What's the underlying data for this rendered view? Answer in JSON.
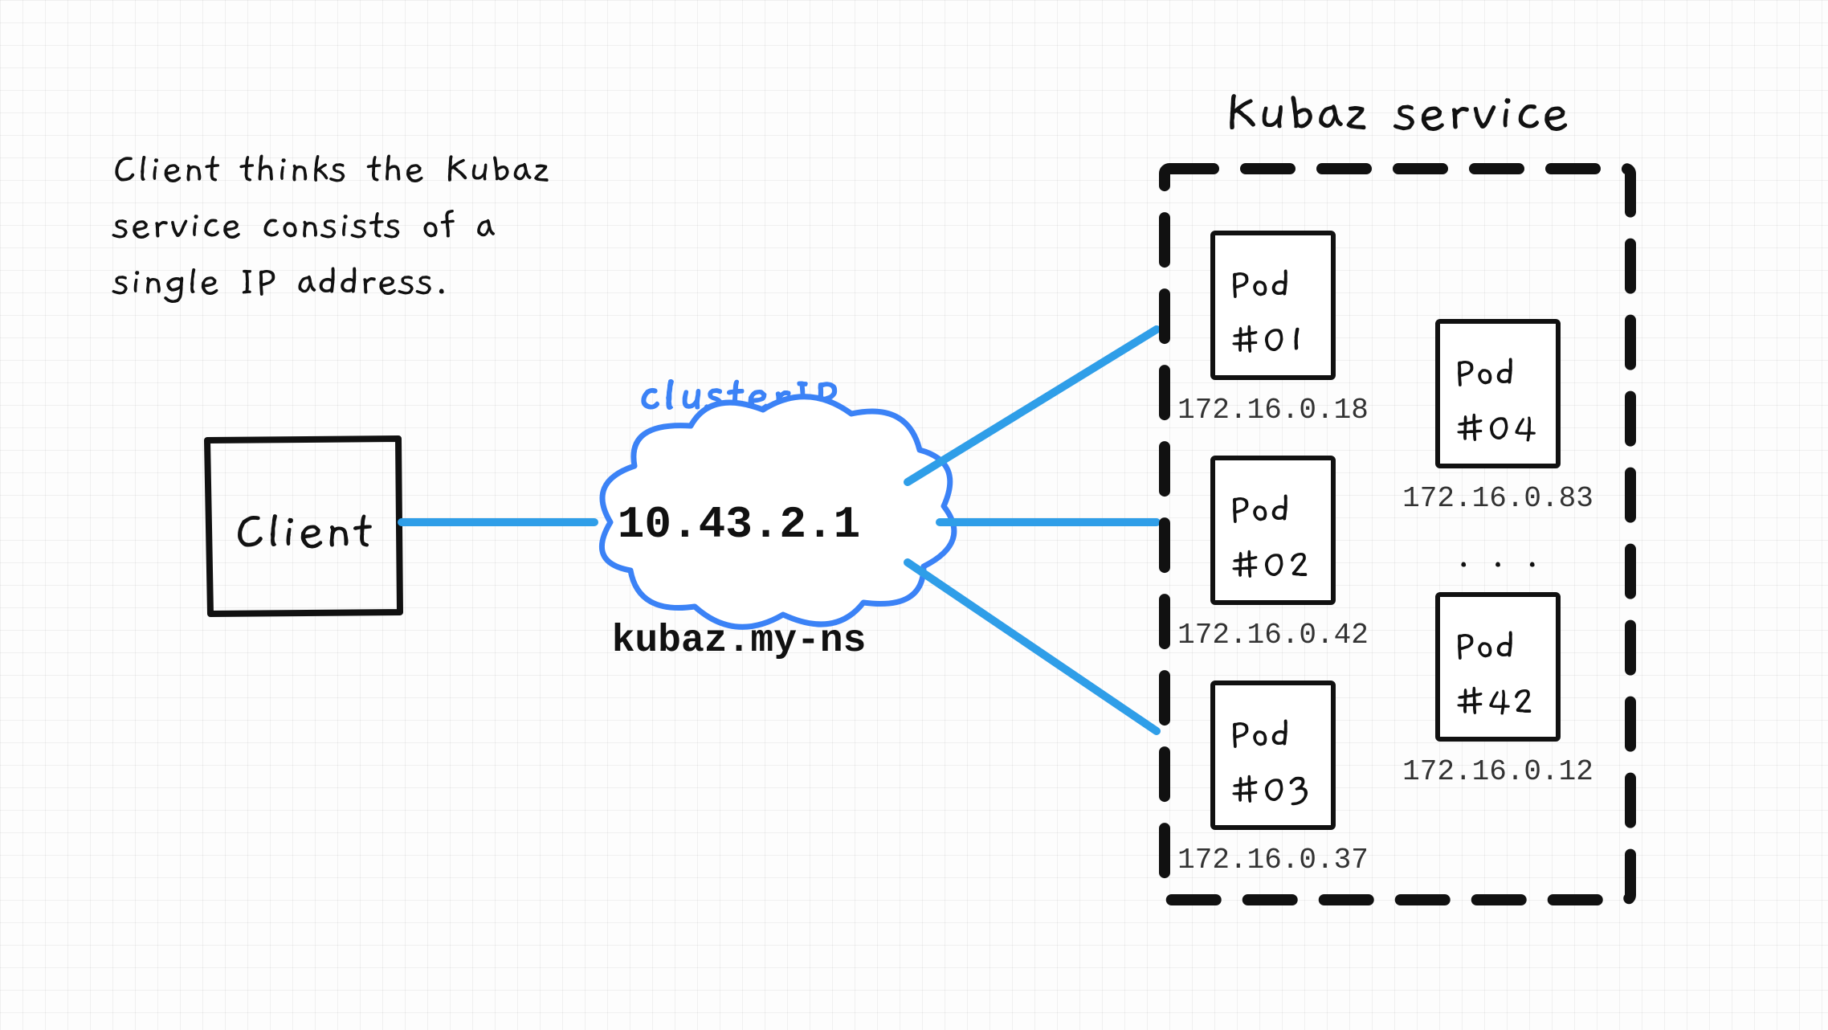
{
  "caption_line1": "Client thinks the Kubaz",
  "caption_line2": "service consists of a",
  "caption_line3": "single IP address.",
  "client_label": "Client",
  "clusterip_label": "clusterIP",
  "clusterip_value": "10.43.2.1",
  "clusterip_dns": "kubaz.my-ns",
  "service_title": "Kubaz service",
  "pods_left": [
    {
      "name_line1": "Pod",
      "name_line2": "#01",
      "ip": "172.16.0.18"
    },
    {
      "name_line1": "Pod",
      "name_line2": "#02",
      "ip": "172.16.0.42"
    },
    {
      "name_line1": "Pod",
      "name_line2": "#03",
      "ip": "172.16.0.37"
    }
  ],
  "pods_right": [
    {
      "name_line1": "Pod",
      "name_line2": "#04",
      "ip": "172.16.0.83"
    },
    {
      "name_line1": "Pod",
      "name_line2": "#42",
      "ip": "172.16.0.12"
    }
  ],
  "ellipsis": ". . .",
  "colors": {
    "blue": "#2f9ee8",
    "blue_text": "#3b82f6",
    "black": "#111111",
    "ip_text": "#333333"
  }
}
